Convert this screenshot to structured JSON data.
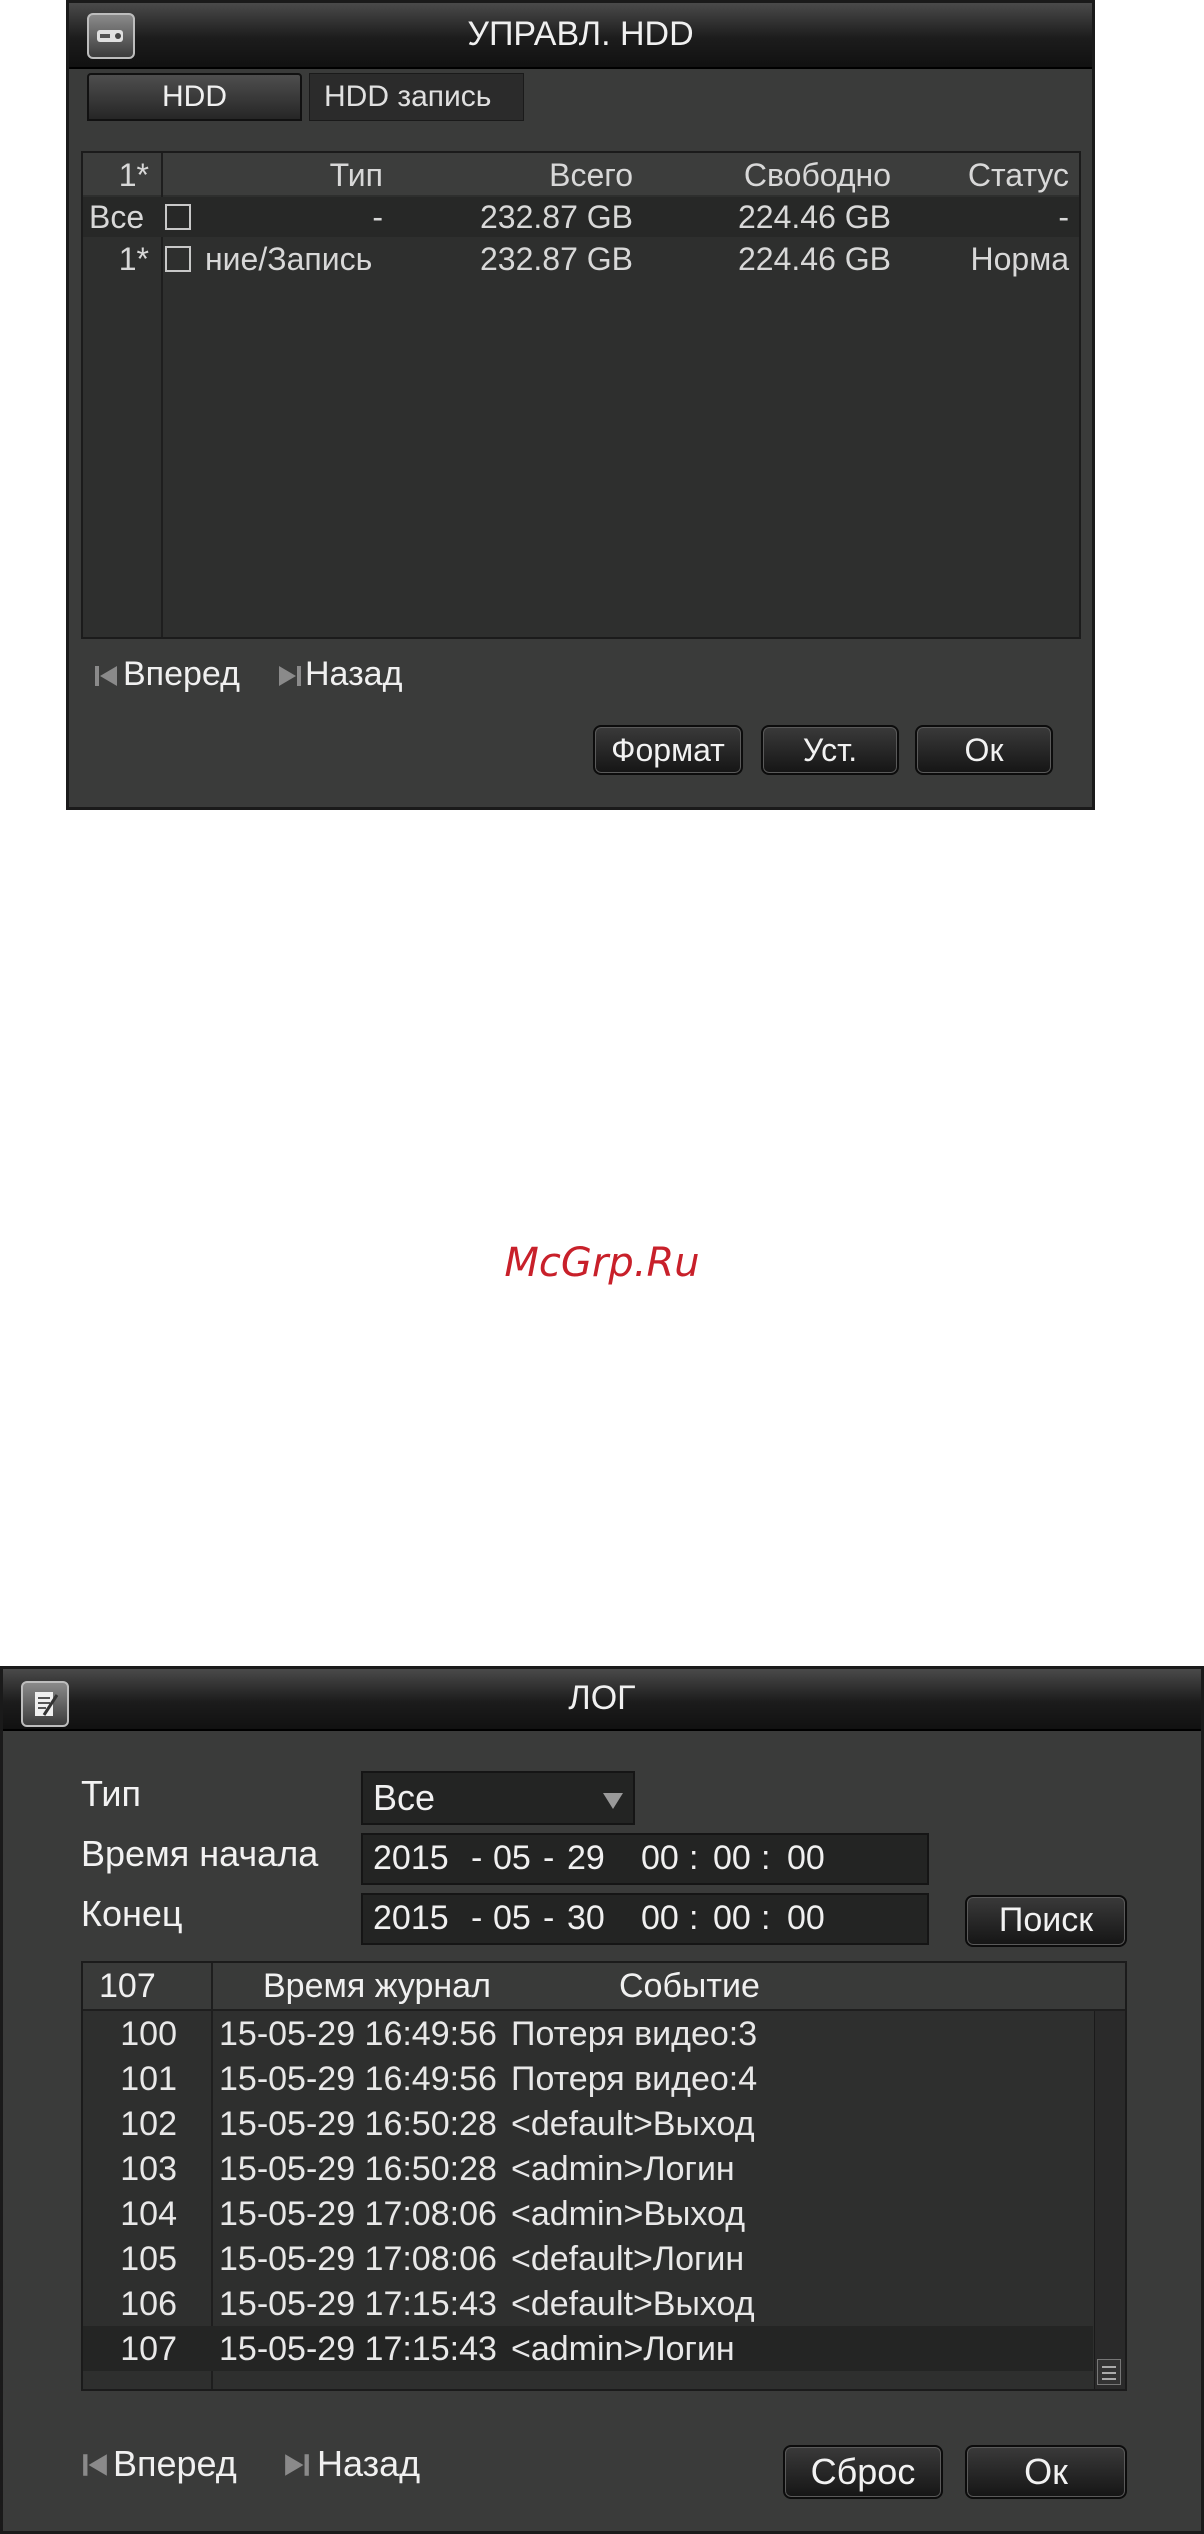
{
  "hdd": {
    "title": "УПРАВЛ. HDD",
    "tabs": [
      "HDD",
      "HDD запись"
    ],
    "columns": {
      "num": "1*",
      "type": "Тип",
      "total": "Всего",
      "free": "Свободно",
      "status": "Статус"
    },
    "rows": [
      {
        "num": "Все",
        "type": "-",
        "total": "232.87 GB",
        "free": "224.46 GB",
        "status": "-"
      },
      {
        "num": "1*",
        "type": "ние/Запись",
        "total": "232.87 GB",
        "free": "224.46 GB",
        "status": "Норма"
      }
    ],
    "nav": {
      "forward": "Вперед",
      "back": "Назад"
    },
    "buttons": {
      "format": "Формат",
      "set": "Уст.",
      "ok": "Ок"
    }
  },
  "watermark": "McGrp.Ru",
  "log": {
    "title": "ЛОГ",
    "type_label": "Тип",
    "type_value": "Все",
    "start_label": "Время начала",
    "start": {
      "year": "2015",
      "month": "05",
      "day": "29",
      "h": "00",
      "m": "00",
      "s": "00"
    },
    "end_label": "Конец",
    "end": {
      "year": "2015",
      "month": "05",
      "day": "30",
      "h": "00",
      "m": "00",
      "s": "00"
    },
    "search_button": "Поиск",
    "columns": {
      "num": "107",
      "time": "Время журнал",
      "event": "Событие"
    },
    "rows": [
      {
        "num": "100",
        "time": "15-05-29 16:49:56",
        "event": "Потеря видео:3"
      },
      {
        "num": "101",
        "time": "15-05-29 16:49:56",
        "event": "Потеря видео:4"
      },
      {
        "num": "102",
        "time": "15-05-29 16:50:28",
        "event": "<default>Выход"
      },
      {
        "num": "103",
        "time": "15-05-29 16:50:28",
        "event": "<admin>Логин"
      },
      {
        "num": "104",
        "time": "15-05-29 17:08:06",
        "event": "<admin>Выход"
      },
      {
        "num": "105",
        "time": "15-05-29 17:08:06",
        "event": "<default>Логин"
      },
      {
        "num": "106",
        "time": "15-05-29 17:15:43",
        "event": "<default>Выход"
      },
      {
        "num": "107",
        "time": "15-05-29 17:15:43",
        "event": "<admin>Логин"
      }
    ],
    "nav": {
      "forward": "Вперед",
      "back": "Назад"
    },
    "buttons": {
      "reset": "Сброс",
      "ok": "Ок"
    }
  }
}
